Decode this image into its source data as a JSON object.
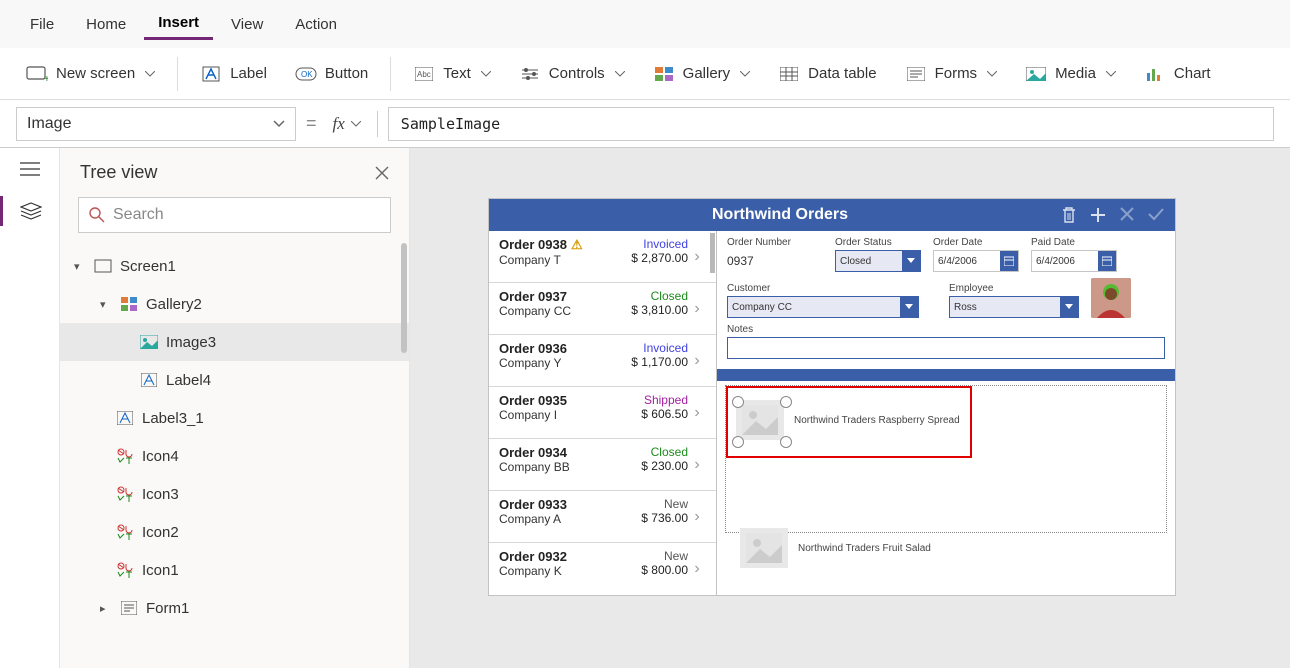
{
  "menu": {
    "file": "File",
    "home": "Home",
    "insert": "Insert",
    "view": "View",
    "action": "Action"
  },
  "ribbon": {
    "newscreen": "New screen",
    "label": "Label",
    "button": "Button",
    "text": "Text",
    "controls": "Controls",
    "gallery": "Gallery",
    "datatable": "Data table",
    "forms": "Forms",
    "media": "Media",
    "chart": "Chart"
  },
  "formula": {
    "property": "Image",
    "value": "SampleImage"
  },
  "tree": {
    "title": "Tree view",
    "searchPlaceholder": "Search",
    "nodes": {
      "screen1": "Screen1",
      "gallery2": "Gallery2",
      "image3": "Image3",
      "label4": "Label4",
      "label3_1": "Label3_1",
      "icon4": "Icon4",
      "icon3": "Icon3",
      "icon2": "Icon2",
      "icon1": "Icon1",
      "form1": "Form1"
    }
  },
  "app": {
    "title": "Northwind Orders",
    "orders": [
      {
        "num": "Order 0938",
        "company": "Company T",
        "status": "Invoiced",
        "amt": "$ 2,870.00",
        "warn": true
      },
      {
        "num": "Order 0937",
        "company": "Company CC",
        "status": "Closed",
        "amt": "$ 3,810.00"
      },
      {
        "num": "Order 0936",
        "company": "Company Y",
        "status": "Invoiced",
        "amt": "$ 1,170.00"
      },
      {
        "num": "Order 0935",
        "company": "Company I",
        "status": "Shipped",
        "amt": "$ 606.50"
      },
      {
        "num": "Order 0934",
        "company": "Company BB",
        "status": "Closed",
        "amt": "$ 230.00"
      },
      {
        "num": "Order 0933",
        "company": "Company A",
        "status": "New",
        "amt": "$ 736.00"
      },
      {
        "num": "Order 0932",
        "company": "Company K",
        "status": "New",
        "amt": "$ 800.00"
      }
    ],
    "form": {
      "orderNumber": {
        "label": "Order Number",
        "value": "0937"
      },
      "orderStatus": {
        "label": "Order Status",
        "value": "Closed"
      },
      "orderDate": {
        "label": "Order Date",
        "value": "6/4/2006"
      },
      "paidDate": {
        "label": "Paid Date",
        "value": "6/4/2006"
      },
      "customer": {
        "label": "Customer",
        "value": "Company CC"
      },
      "employee": {
        "label": "Employee",
        "value": "Ross"
      },
      "notes": {
        "label": "Notes"
      }
    },
    "gallery": {
      "item0": "Northwind Traders Raspberry Spread",
      "item1": "Northwind Traders Fruit Salad"
    }
  }
}
